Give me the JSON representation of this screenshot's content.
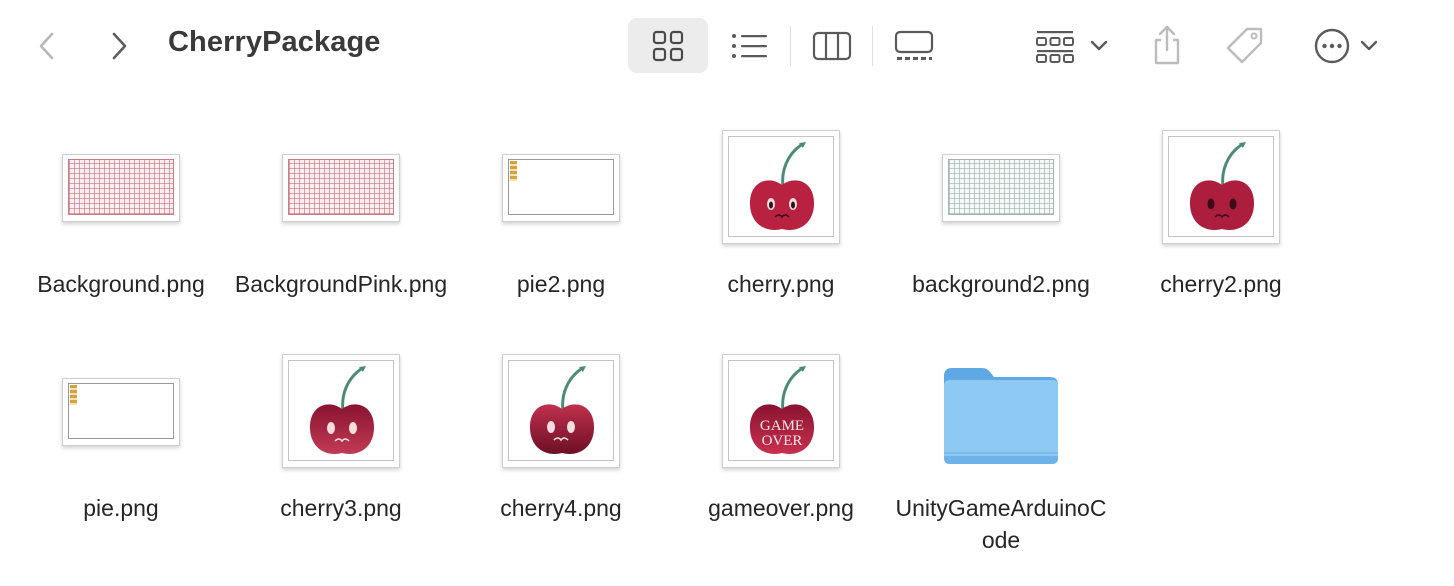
{
  "toolbar": {
    "title": "CherryPackage",
    "icons": [
      "back-chevron-icon",
      "forward-chevron-icon",
      "grid-view-icon",
      "list-view-icon",
      "column-view-icon",
      "gallery-view-icon",
      "group-by-icon",
      "chevron-down-icon",
      "share-icon",
      "tag-icon",
      "more-icon",
      "chevron-down-icon"
    ],
    "active_view": "icon"
  },
  "items": [
    {
      "name": "Background.png",
      "kind": "grid-pink"
    },
    {
      "name": "BackgroundPink.png",
      "kind": "grid-pink"
    },
    {
      "name": "pie2.png",
      "kind": "pie"
    },
    {
      "name": "cherry.png",
      "kind": "cherry-face"
    },
    {
      "name": "background2.png",
      "kind": "grid-gray"
    },
    {
      "name": "cherry2.png",
      "kind": "cherry-face"
    },
    {
      "name": "pie.png",
      "kind": "pie"
    },
    {
      "name": "cherry3.png",
      "kind": "cherry-face"
    },
    {
      "name": "cherry4.png",
      "kind": "cherry-face"
    },
    {
      "name": "gameover.png",
      "kind": "cherry-gameover",
      "overlay_text": [
        "GAME",
        "OVER"
      ]
    },
    {
      "name": "UnityGameArduinoCode",
      "kind": "folder"
    }
  ],
  "colors": {
    "cherry": "#b8213f",
    "cherry_dark": "#8a1330",
    "stem": "#4e8a7a",
    "folder_body": "#8ec9f3",
    "folder_tab": "#5ea8e3"
  }
}
